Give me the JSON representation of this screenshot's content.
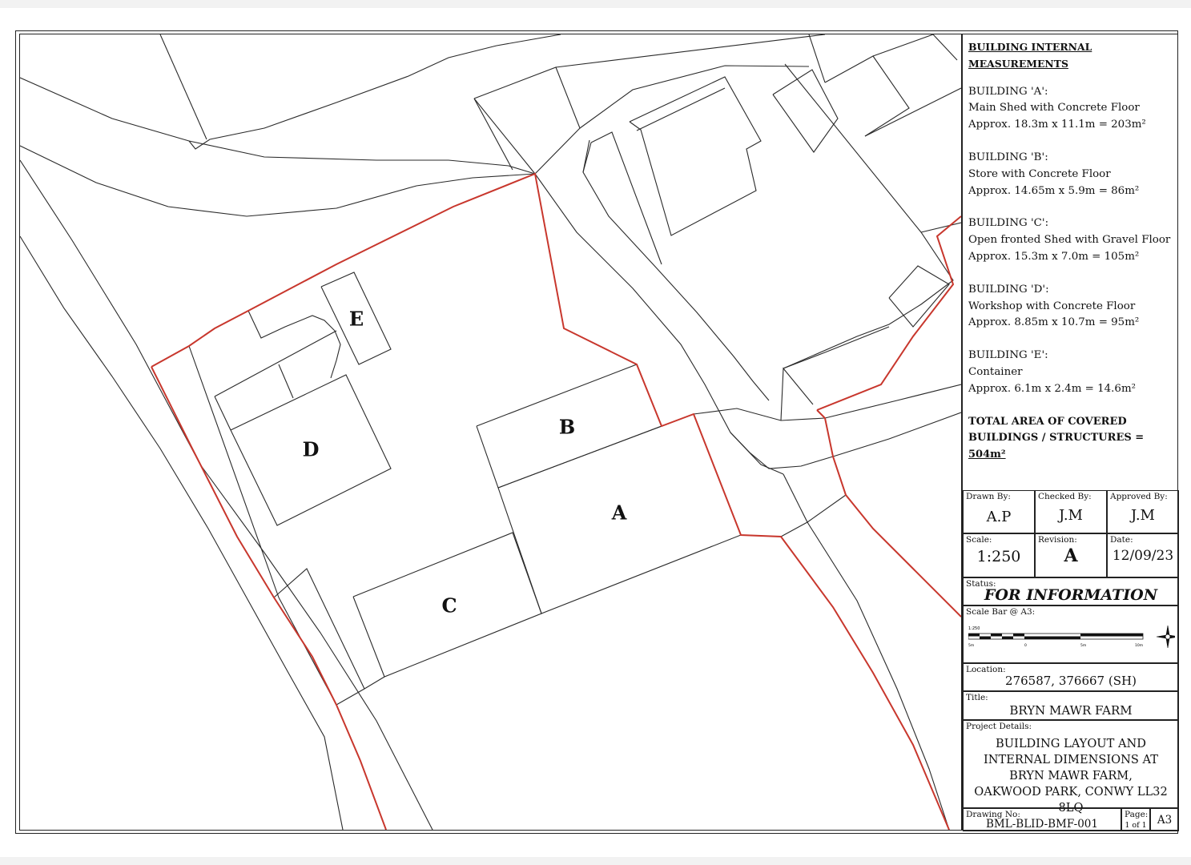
{
  "map": {
    "labels": {
      "A": "A",
      "B": "B",
      "C": "C",
      "D": "D",
      "E": "E"
    },
    "boundary_color": "#c8372d",
    "line_color": "#2a2a2a"
  },
  "measurements": {
    "heading": "BUILDING INTERNAL MEASUREMENTS",
    "buildings": [
      {
        "name": "BUILDING 'A':",
        "desc": "Main Shed with Concrete Floor",
        "dims": "Approx. 18.3m x 11.1m = 203m²"
      },
      {
        "name": "BUILDING 'B':",
        "desc": "Store with Concrete Floor",
        "dims": "Approx. 14.65m x 5.9m = 86m²"
      },
      {
        "name": "BUILDING 'C':",
        "desc": "Open fronted Shed with Gravel Floor",
        "dims": "Approx. 15.3m x 7.0m = 105m²"
      },
      {
        "name": "BUILDING 'D':",
        "desc": "Workshop with Concrete Floor",
        "dims": "Approx. 8.85m x 10.7m = 95m²"
      },
      {
        "name": "BUILDING 'E':",
        "desc": "Container",
        "dims": "Approx. 6.1m x 2.4m = 14.6m²"
      }
    ],
    "total_label": "TOTAL AREA OF COVERED BUILDINGS / STRUCTURES = ",
    "total_value": "504m²"
  },
  "titleblock": {
    "drawn_by_label": "Drawn By:",
    "drawn_by": "A.P",
    "checked_by_label": "Checked By:",
    "checked_by": "J.M",
    "approved_by_label": "Approved By:",
    "approved_by": "J.M",
    "scale_label": "Scale:",
    "scale": "1:250",
    "revision_label": "Revision:",
    "revision": "A",
    "date_label": "Date:",
    "date": "12/09/23",
    "status_label": "Status:",
    "status": "FOR INFORMATION",
    "scalebar_label": "Scale Bar @ A3:",
    "scalebar_ratio": "1:250",
    "scalebar_ticks": [
      "5m",
      "0",
      "5m",
      "10m"
    ],
    "location_label": "Location:",
    "location": "276587, 376667 (SH)",
    "title_label": "Title:",
    "title": "BRYN MAWR FARM",
    "project_label": "Project Details:",
    "project_lines": [
      "BUILDING LAYOUT AND",
      "INTERNAL DIMENSIONS AT",
      "BRYN MAWR FARM,",
      "OAKWOOD PARK, CONWY LL32 8LQ"
    ],
    "drawing_no_label": "Drawing No:",
    "drawing_no": "BML-BLID-BMF-001",
    "page_label": "Page:",
    "page": "1 of 1",
    "sheet_size": "A3"
  }
}
